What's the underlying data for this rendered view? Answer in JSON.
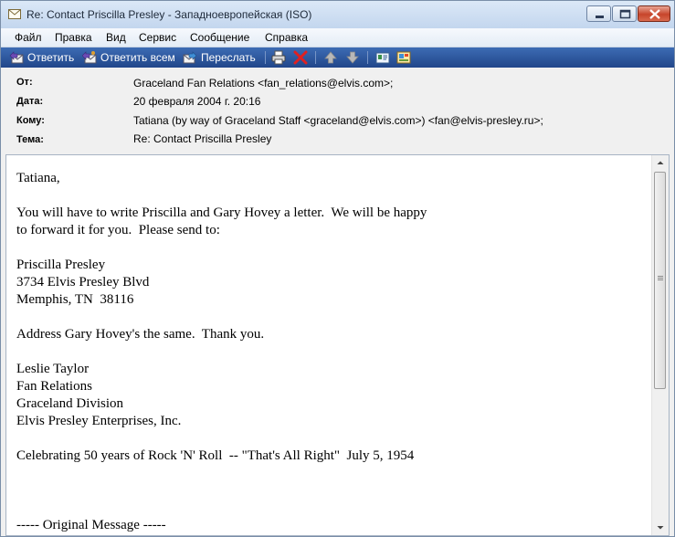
{
  "window": {
    "title": "Re: Contact Priscilla Presley - Западноевропейская (ISO)"
  },
  "menu": [
    "Файл",
    "Правка",
    "Вид",
    "Сервис",
    "Сообщение",
    "Справка"
  ],
  "toolbar": {
    "reply": "Ответить",
    "reply_all": "Ответить всем",
    "forward": "Переслать",
    "icons": [
      "print-icon",
      "delete-icon",
      "previous-icon",
      "next-icon",
      "address-book-icon",
      "contacts-icon"
    ]
  },
  "headers": [
    {
      "label": "От:",
      "value": "Graceland Fan Relations <fan_relations@elvis.com>;"
    },
    {
      "label": "Дата:",
      "value": "20 февраля 2004 г. 20:16"
    },
    {
      "label": "Кому:",
      "value": "Tatiana (by way of Graceland Staff <graceland@elvis.com>) <fan@elvis-presley.ru>;"
    },
    {
      "label": "Тема:",
      "value": "Re: Contact Priscilla Presley"
    }
  ],
  "message": {
    "lines": [
      "Tatiana,",
      "",
      "You will have to write Priscilla and Gary Hovey a letter.  We will be happy",
      "to forward it for you.  Please send to:",
      "",
      "Priscilla Presley",
      "3734 Elvis Presley Blvd",
      "Memphis, TN  38116",
      "",
      "Address Gary Hovey's the same.  Thank you.",
      "",
      "Leslie Taylor",
      "Fan Relations",
      "Graceland Division",
      "Elvis Presley Enterprises, Inc.",
      "",
      "Celebrating 50 years of Rock 'N' Roll  -- \"That's All Right\"  July 5, 1954",
      "",
      "",
      "",
      "----- Original Message -----"
    ]
  },
  "colors": {
    "toolbar": "#2b55a0",
    "titlebar": "#cfdff2",
    "close_button": "#c7452b"
  }
}
